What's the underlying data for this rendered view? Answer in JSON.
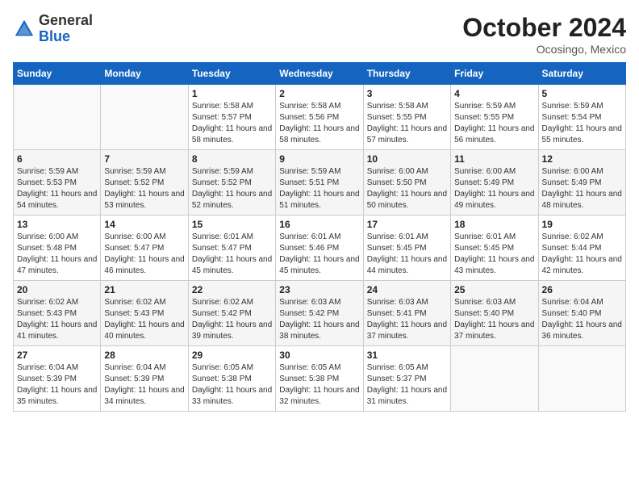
{
  "header": {
    "logo": {
      "general": "General",
      "blue": "Blue"
    },
    "title": "October 2024",
    "location": "Ocosingo, Mexico"
  },
  "days_of_week": [
    "Sunday",
    "Monday",
    "Tuesday",
    "Wednesday",
    "Thursday",
    "Friday",
    "Saturday"
  ],
  "weeks": [
    [
      {
        "num": "",
        "info": ""
      },
      {
        "num": "",
        "info": ""
      },
      {
        "num": "1",
        "info": "Sunrise: 5:58 AM\nSunset: 5:57 PM\nDaylight: 11 hours and 58 minutes."
      },
      {
        "num": "2",
        "info": "Sunrise: 5:58 AM\nSunset: 5:56 PM\nDaylight: 11 hours and 58 minutes."
      },
      {
        "num": "3",
        "info": "Sunrise: 5:58 AM\nSunset: 5:55 PM\nDaylight: 11 hours and 57 minutes."
      },
      {
        "num": "4",
        "info": "Sunrise: 5:59 AM\nSunset: 5:55 PM\nDaylight: 11 hours and 56 minutes."
      },
      {
        "num": "5",
        "info": "Sunrise: 5:59 AM\nSunset: 5:54 PM\nDaylight: 11 hours and 55 minutes."
      }
    ],
    [
      {
        "num": "6",
        "info": "Sunrise: 5:59 AM\nSunset: 5:53 PM\nDaylight: 11 hours and 54 minutes."
      },
      {
        "num": "7",
        "info": "Sunrise: 5:59 AM\nSunset: 5:52 PM\nDaylight: 11 hours and 53 minutes."
      },
      {
        "num": "8",
        "info": "Sunrise: 5:59 AM\nSunset: 5:52 PM\nDaylight: 11 hours and 52 minutes."
      },
      {
        "num": "9",
        "info": "Sunrise: 5:59 AM\nSunset: 5:51 PM\nDaylight: 11 hours and 51 minutes."
      },
      {
        "num": "10",
        "info": "Sunrise: 6:00 AM\nSunset: 5:50 PM\nDaylight: 11 hours and 50 minutes."
      },
      {
        "num": "11",
        "info": "Sunrise: 6:00 AM\nSunset: 5:49 PM\nDaylight: 11 hours and 49 minutes."
      },
      {
        "num": "12",
        "info": "Sunrise: 6:00 AM\nSunset: 5:49 PM\nDaylight: 11 hours and 48 minutes."
      }
    ],
    [
      {
        "num": "13",
        "info": "Sunrise: 6:00 AM\nSunset: 5:48 PM\nDaylight: 11 hours and 47 minutes."
      },
      {
        "num": "14",
        "info": "Sunrise: 6:00 AM\nSunset: 5:47 PM\nDaylight: 11 hours and 46 minutes."
      },
      {
        "num": "15",
        "info": "Sunrise: 6:01 AM\nSunset: 5:47 PM\nDaylight: 11 hours and 45 minutes."
      },
      {
        "num": "16",
        "info": "Sunrise: 6:01 AM\nSunset: 5:46 PM\nDaylight: 11 hours and 45 minutes."
      },
      {
        "num": "17",
        "info": "Sunrise: 6:01 AM\nSunset: 5:45 PM\nDaylight: 11 hours and 44 minutes."
      },
      {
        "num": "18",
        "info": "Sunrise: 6:01 AM\nSunset: 5:45 PM\nDaylight: 11 hours and 43 minutes."
      },
      {
        "num": "19",
        "info": "Sunrise: 6:02 AM\nSunset: 5:44 PM\nDaylight: 11 hours and 42 minutes."
      }
    ],
    [
      {
        "num": "20",
        "info": "Sunrise: 6:02 AM\nSunset: 5:43 PM\nDaylight: 11 hours and 41 minutes."
      },
      {
        "num": "21",
        "info": "Sunrise: 6:02 AM\nSunset: 5:43 PM\nDaylight: 11 hours and 40 minutes."
      },
      {
        "num": "22",
        "info": "Sunrise: 6:02 AM\nSunset: 5:42 PM\nDaylight: 11 hours and 39 minutes."
      },
      {
        "num": "23",
        "info": "Sunrise: 6:03 AM\nSunset: 5:42 PM\nDaylight: 11 hours and 38 minutes."
      },
      {
        "num": "24",
        "info": "Sunrise: 6:03 AM\nSunset: 5:41 PM\nDaylight: 11 hours and 37 minutes."
      },
      {
        "num": "25",
        "info": "Sunrise: 6:03 AM\nSunset: 5:40 PM\nDaylight: 11 hours and 37 minutes."
      },
      {
        "num": "26",
        "info": "Sunrise: 6:04 AM\nSunset: 5:40 PM\nDaylight: 11 hours and 36 minutes."
      }
    ],
    [
      {
        "num": "27",
        "info": "Sunrise: 6:04 AM\nSunset: 5:39 PM\nDaylight: 11 hours and 35 minutes."
      },
      {
        "num": "28",
        "info": "Sunrise: 6:04 AM\nSunset: 5:39 PM\nDaylight: 11 hours and 34 minutes."
      },
      {
        "num": "29",
        "info": "Sunrise: 6:05 AM\nSunset: 5:38 PM\nDaylight: 11 hours and 33 minutes."
      },
      {
        "num": "30",
        "info": "Sunrise: 6:05 AM\nSunset: 5:38 PM\nDaylight: 11 hours and 32 minutes."
      },
      {
        "num": "31",
        "info": "Sunrise: 6:05 AM\nSunset: 5:37 PM\nDaylight: 11 hours and 31 minutes."
      },
      {
        "num": "",
        "info": ""
      },
      {
        "num": "",
        "info": ""
      }
    ]
  ]
}
